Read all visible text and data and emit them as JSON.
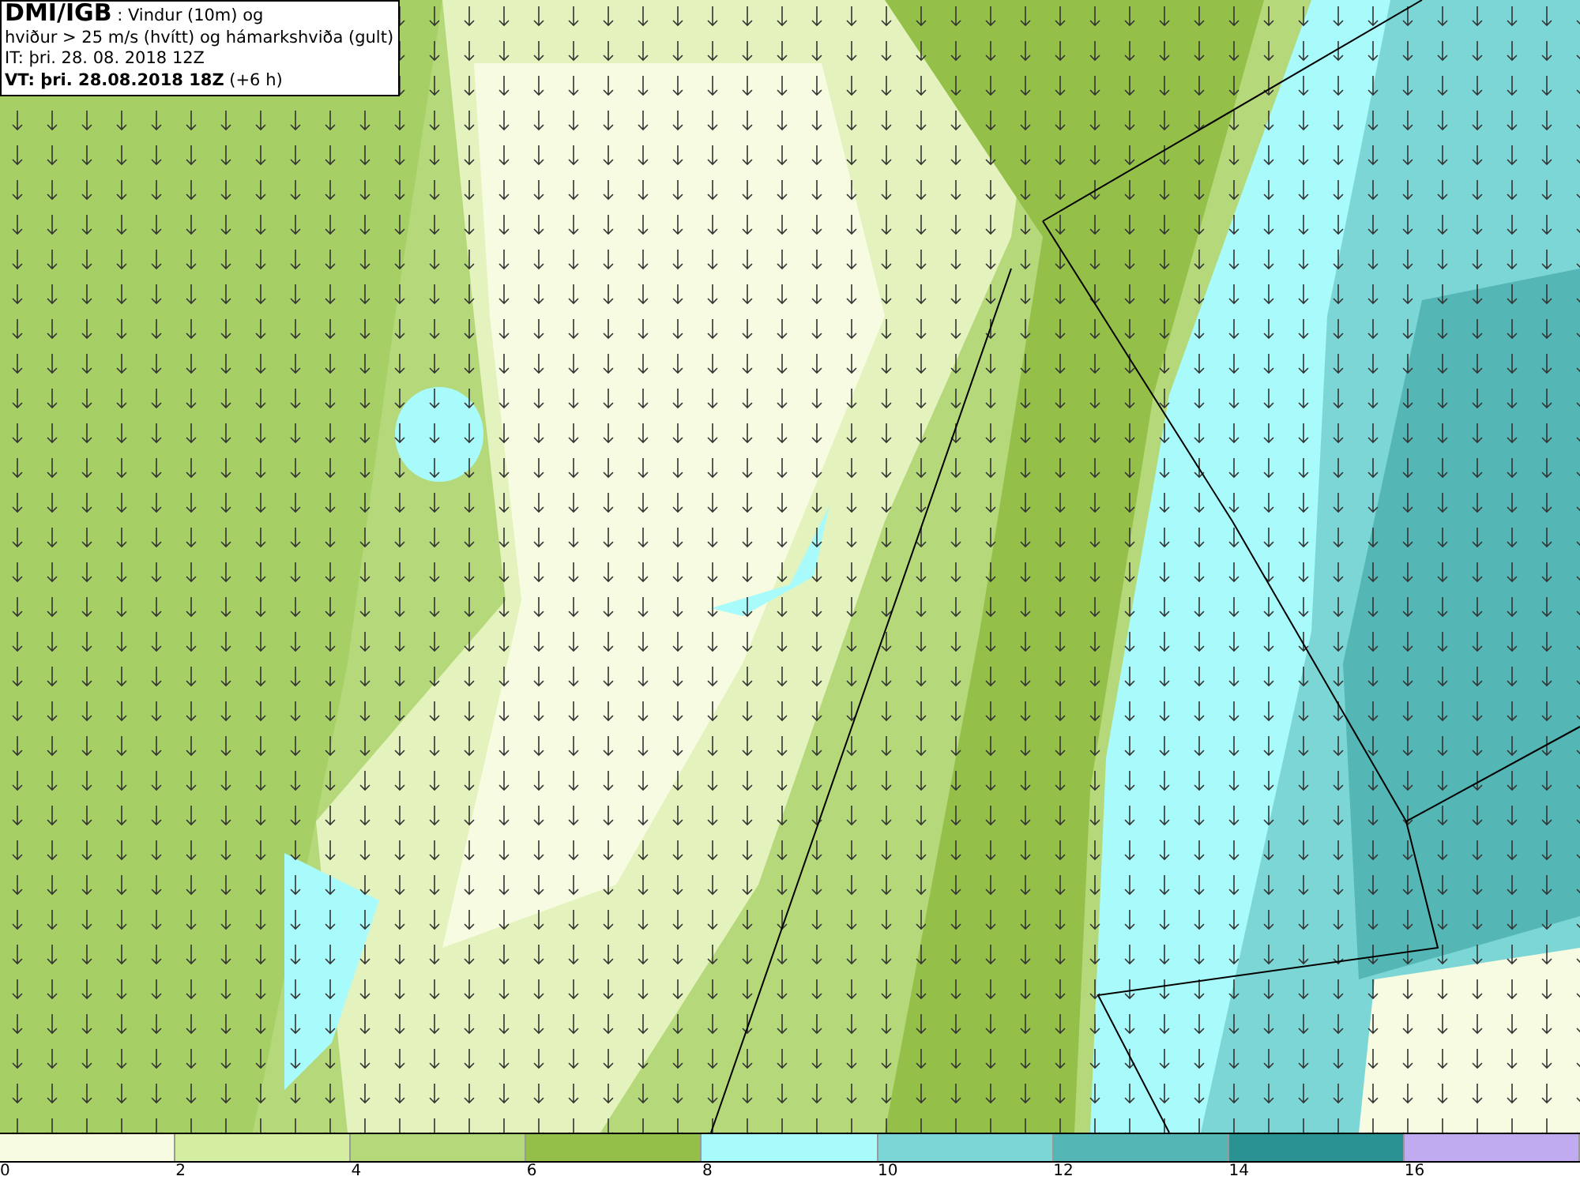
{
  "header": {
    "source": "DMI/IGB",
    "variable": ": Vindur (10m) og",
    "line_2": "hviður > 25 m/s (hvítt) og hámarkshviða (gult)",
    "issue_time": "IT: þri. 28. 08. 2018 12Z",
    "valid_time": "VT: þri. 28.08.2018 18Z",
    "lead": "(+6 h)"
  },
  "legend": {
    "bins": [
      {
        "color": "#f7fbe1"
      },
      {
        "color": "#d4eda0"
      },
      {
        "color": "#b5d97a"
      },
      {
        "color": "#94bf48"
      },
      {
        "color": "#a8fbfa"
      },
      {
        "color": "#7dd6d6"
      },
      {
        "color": "#55b6b6"
      },
      {
        "color": "#2a9292"
      },
      {
        "color": "#c0aaf0"
      }
    ],
    "ticks": [
      "0",
      "2",
      "4",
      "6",
      "8",
      "10",
      "12",
      "14",
      "16"
    ]
  }
}
